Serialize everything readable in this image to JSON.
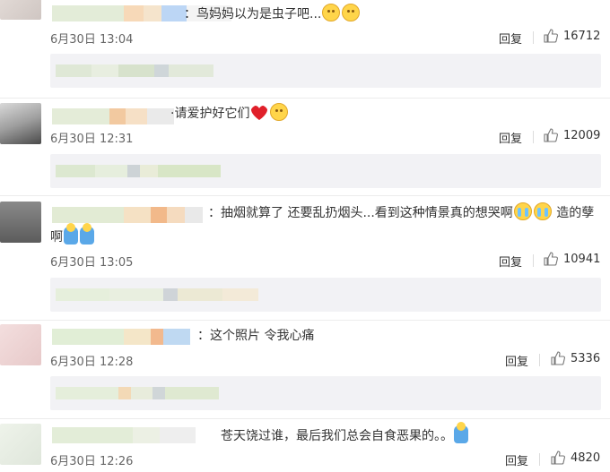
{
  "comments": [
    {
      "text": "：鸟妈妈以为是虫子吧...",
      "emojis": [
        "smile",
        "smile"
      ],
      "date": "6月30日 13:04",
      "reply_label": "回复",
      "likes": "16712"
    },
    {
      "text": "·请爱护好它们",
      "emojis": [
        "heart",
        "smile"
      ],
      "date": "6月30日 12:31",
      "reply_label": "回复",
      "likes": "12009"
    },
    {
      "text": "：抽烟就算了 还要乱扔烟头...看到这种情景真的想哭啊",
      "text2_suffix": " 造的孽",
      "text_line2": "啊",
      "emojis": [
        "cry",
        "cry"
      ],
      "emojis_line2": [
        "kneel",
        "kneel"
      ],
      "date": "6月30日 13:05",
      "reply_label": "回复",
      "likes": "10941"
    },
    {
      "text": "：这个照片  令我心痛",
      "date": "6月30日 12:28",
      "reply_label": "回复",
      "likes": "5336"
    },
    {
      "text": "苍天饶过谁，最后我们总会自食恶果的。。",
      "emojis": [
        "kneel"
      ],
      "date": "6月30日 12:26",
      "reply_label": "回复",
      "likes": "4820"
    }
  ],
  "colors": {
    "text": "#333333",
    "meta": "#666666",
    "subreply_bg": "#f2f2f5",
    "emoji_yellow": "#ffd54a",
    "heart_red": "#e0202a"
  },
  "icons": [
    "thumbs-up-icon",
    "smile-emoji-icon",
    "heart-emoji-icon",
    "crying-emoji-icon",
    "kneeling-emoji-icon"
  ]
}
